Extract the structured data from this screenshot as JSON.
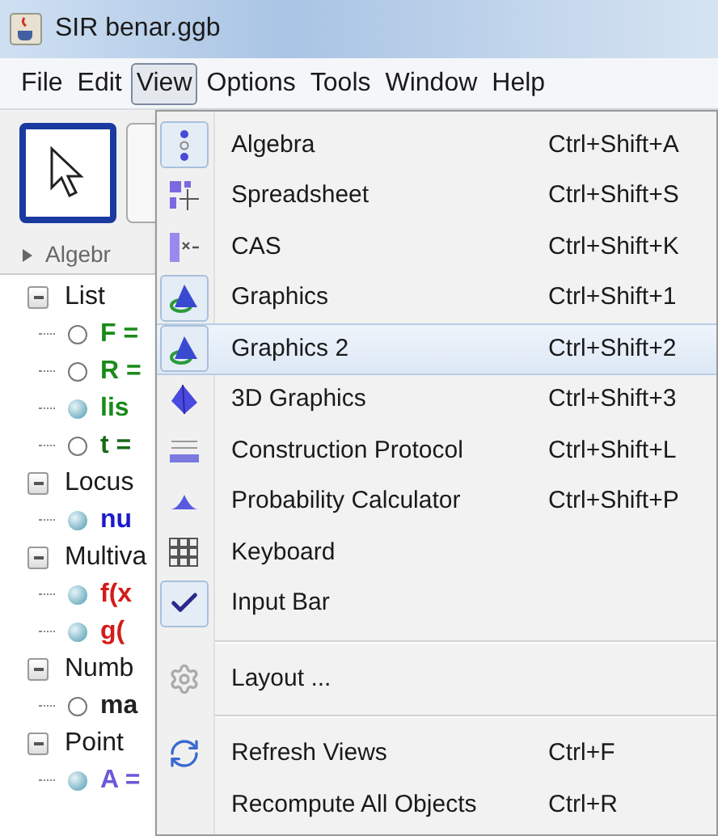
{
  "window": {
    "title": "SIR benar.ggb"
  },
  "menubar": [
    {
      "label": "File",
      "selected": false
    },
    {
      "label": "Edit",
      "selected": false
    },
    {
      "label": "View",
      "selected": true
    },
    {
      "label": "Options",
      "selected": false
    },
    {
      "label": "Tools",
      "selected": false
    },
    {
      "label": "Window",
      "selected": false
    },
    {
      "label": "Help",
      "selected": false
    }
  ],
  "toolbar": {
    "tools": [
      {
        "selected": true
      },
      {
        "selected": false
      }
    ]
  },
  "algebra_panel": {
    "title": "Algebr",
    "expanded": false,
    "groups": [
      {
        "label": "List",
        "expanded": true,
        "children": [
          {
            "label": "F =",
            "visible": false,
            "color": "#1a8a1a"
          },
          {
            "label": "R =",
            "visible": false,
            "color": "#1a8a1a"
          },
          {
            "label": "lis",
            "visible": true,
            "color": "#1a8a1a"
          },
          {
            "label": "t =",
            "visible": false,
            "color": "#1a6a1a"
          }
        ]
      },
      {
        "label": "Locus",
        "expanded": true,
        "children": [
          {
            "label": "nu",
            "visible": true,
            "color": "#1a1acc"
          }
        ]
      },
      {
        "label": "Multiva",
        "expanded": true,
        "children": [
          {
            "label": "f(x",
            "visible": true,
            "color": "#d41a1a"
          },
          {
            "label": "g(",
            "visible": true,
            "color": "#d41a1a"
          }
        ]
      },
      {
        "label": "Numb",
        "expanded": true,
        "children": [
          {
            "label": "ma",
            "visible": false,
            "color": "#222222"
          }
        ]
      },
      {
        "label": "Point",
        "expanded": true,
        "children": [
          {
            "label": "A =",
            "visible": true,
            "color": "#6a5ad8"
          }
        ]
      }
    ]
  },
  "view_menu": [
    {
      "kind": "item",
      "label": "Algebra",
      "shortcut": "Ctrl+Shift+A",
      "checked": true,
      "selected": false
    },
    {
      "kind": "item",
      "label": "Spreadsheet",
      "shortcut": "Ctrl+Shift+S",
      "checked": false,
      "selected": false
    },
    {
      "kind": "item",
      "label": "CAS",
      "shortcut": "Ctrl+Shift+K",
      "checked": false,
      "selected": false
    },
    {
      "kind": "item",
      "label": "Graphics",
      "shortcut": "Ctrl+Shift+1",
      "checked": true,
      "selected": false
    },
    {
      "kind": "item",
      "label": "Graphics 2",
      "shortcut": "Ctrl+Shift+2",
      "checked": true,
      "selected": true
    },
    {
      "kind": "item",
      "label": "3D Graphics",
      "shortcut": "Ctrl+Shift+3",
      "checked": false,
      "selected": false
    },
    {
      "kind": "item",
      "label": "Construction Protocol",
      "shortcut": "Ctrl+Shift+L",
      "checked": false,
      "selected": false
    },
    {
      "kind": "item",
      "label": "Probability Calculator",
      "shortcut": "Ctrl+Shift+P",
      "checked": false,
      "selected": false
    },
    {
      "kind": "item",
      "label": "Keyboard",
      "checked": false,
      "selected": false
    },
    {
      "kind": "item",
      "label": "Input Bar",
      "checked": true,
      "selected": false
    },
    {
      "kind": "separator"
    },
    {
      "kind": "item",
      "label": "Layout ...",
      "checked": false,
      "selected": false
    },
    {
      "kind": "separator"
    },
    {
      "kind": "item",
      "label": "Refresh Views",
      "shortcut": "Ctrl+F",
      "checked": false,
      "selected": false
    },
    {
      "kind": "item",
      "label": "Recompute All Objects",
      "shortcut": "Ctrl+R",
      "checked": false,
      "selected": false
    }
  ]
}
